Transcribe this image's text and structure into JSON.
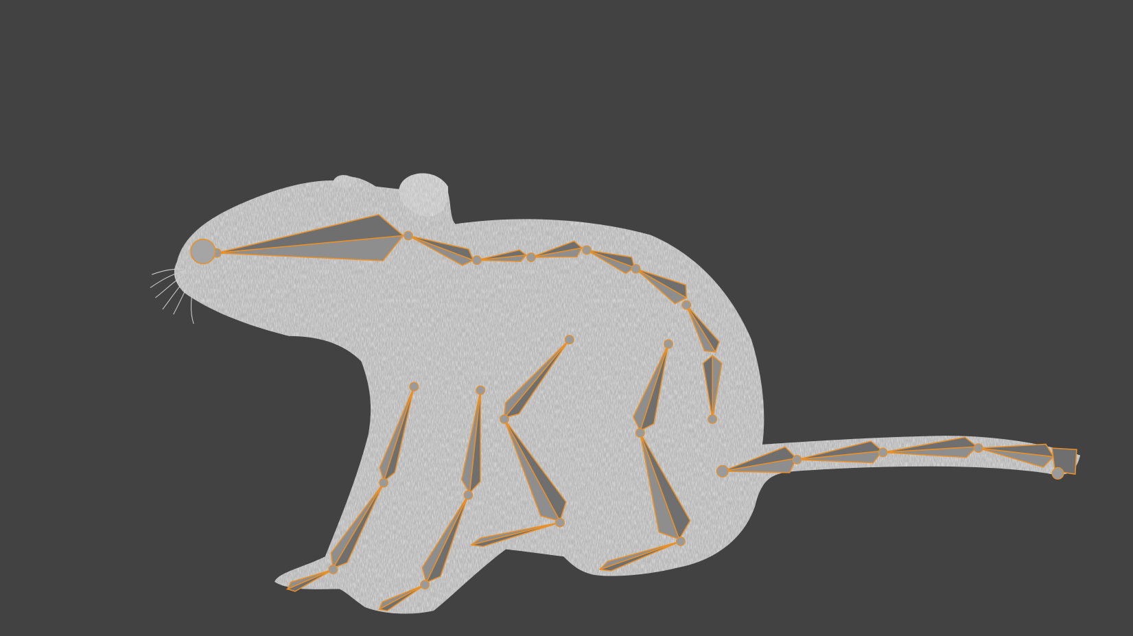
{
  "viewport": {
    "background_color": "#424242",
    "mesh_color": "#b9b9b9",
    "mesh_highlight_color": "#dcdcdc",
    "bone_fill_color": "#8e8e8e",
    "bone_shade_color": "#6f6f6f",
    "bone_outline_color": "#e8912a",
    "icons": [
      "rat-mesh",
      "armature-bones"
    ]
  }
}
